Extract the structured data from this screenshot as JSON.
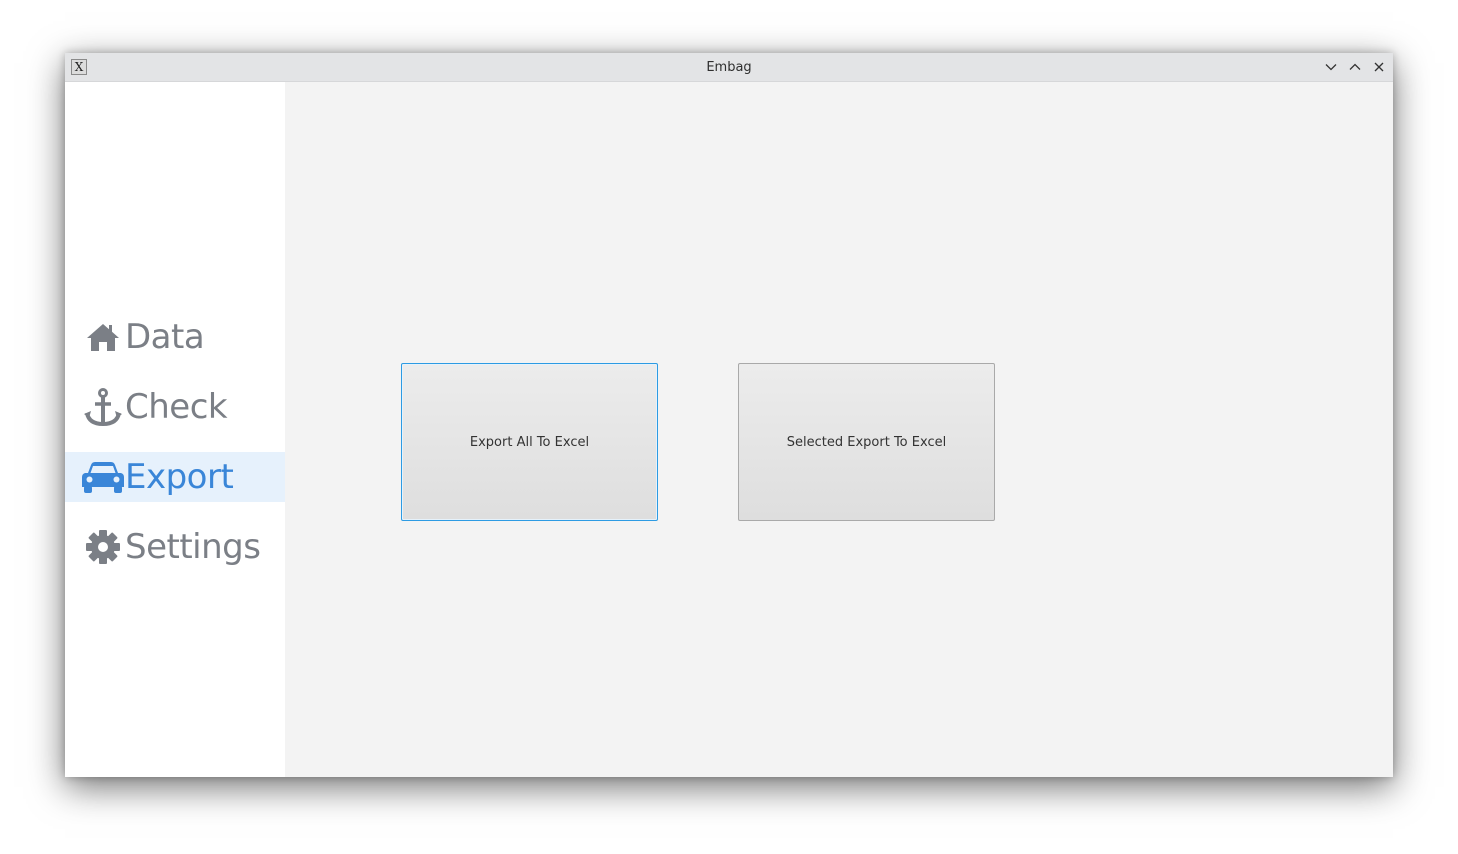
{
  "window": {
    "title": "Embag",
    "app_icon_glyph": "X"
  },
  "sidebar": {
    "items": [
      {
        "label": "Data",
        "icon": "home-icon",
        "active": false
      },
      {
        "label": "Check",
        "icon": "anchor-icon",
        "active": false
      },
      {
        "label": "Export",
        "icon": "car-icon",
        "active": true
      },
      {
        "label": "Settings",
        "icon": "gear-icon",
        "active": false
      }
    ]
  },
  "main": {
    "export_all_label": "Export All To Excel",
    "selected_export_label": "Selected Export To Excel"
  },
  "colors": {
    "accent": "#3a86d8",
    "nav_text": "#7b7f86",
    "active_bg": "#e6f1fc",
    "focus_border": "#2d9be3"
  }
}
